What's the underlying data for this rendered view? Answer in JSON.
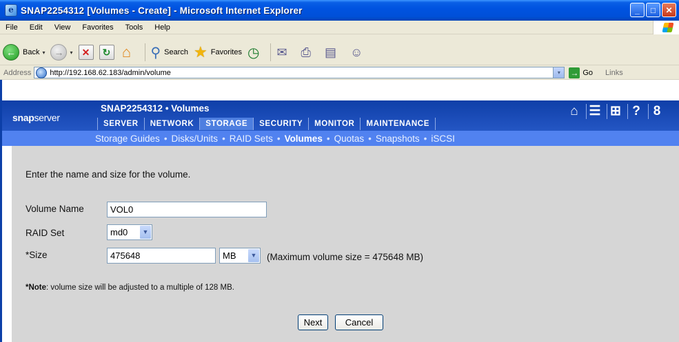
{
  "window": {
    "title": "SNAP2254312 [Volumes - Create] - Microsoft Internet Explorer",
    "minimize": "_",
    "maximize": "□",
    "close": "✕"
  },
  "menu": [
    "File",
    "Edit",
    "View",
    "Favorites",
    "Tools",
    "Help"
  ],
  "toolbar": {
    "back_label": "Back",
    "search_label": "Search",
    "favorites_label": "Favorites",
    "dropdown_arrow": "▾"
  },
  "address": {
    "label": "Address",
    "url": "http://192.168.62.183/admin/volume",
    "go_label": "Go",
    "links_label": "Links"
  },
  "header": {
    "logo_bold": "snap",
    "logo_light": "server",
    "server_title": "SNAP2254312 • Volumes",
    "tabs": [
      "SERVER",
      "NETWORK",
      "STORAGE",
      "SECURITY",
      "MONITOR",
      "MAINTENANCE"
    ],
    "active_tab": "STORAGE",
    "icons": [
      "home-icon",
      "server-icon",
      "network-icon",
      "help-icon",
      "logout-icon"
    ]
  },
  "subnav": {
    "items": [
      "Storage Guides",
      "Disks/Units",
      "RAID Sets",
      "Volumes",
      "Quotas",
      "Snapshots",
      "iSCSI"
    ],
    "active": "Volumes",
    "separator": "•"
  },
  "form": {
    "intro": "Enter the name and size for the volume.",
    "volume_name_label": "Volume Name",
    "volume_name_value": "VOL0",
    "raid_set_label": "RAID Set",
    "raid_set_value": "md0",
    "size_label": "*Size",
    "size_value": "475648",
    "size_unit": "MB",
    "max_size_text": "(Maximum volume size = 475648 MB)",
    "note_bold": "*Note",
    "note_text": ": volume size will be adjusted to a multiple of 128 MB.",
    "next_button": "Next",
    "cancel_button": "Cancel"
  },
  "colors": {
    "title_bar": "#0053e0",
    "snap_header": "#1a4ab8",
    "subnav_bg": "#5182f0",
    "content_bg": "#d6d6d6"
  }
}
